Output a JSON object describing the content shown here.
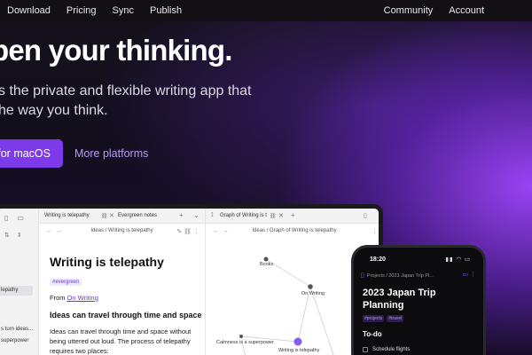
{
  "nav": {
    "left": [
      "Download",
      "Pricing",
      "Sync",
      "Publish"
    ],
    "right": [
      "Community",
      "Account"
    ]
  },
  "hero": {
    "headline": "pen your thinking.",
    "subtitle_line1": "s the private and flexible writing app that",
    "subtitle_line2": "he way you think.",
    "primary_button": "a for macOS",
    "secondary_link": "More platforms"
  },
  "colors": {
    "accent": "#7c3ae8",
    "link": "#b79cf5",
    "background": "#0d0b14"
  },
  "laptop": {
    "sidebar": {
      "active_item": "lepathy",
      "item1": "s turn ideas...",
      "item2": "superpower"
    },
    "pane1": {
      "tab_active": "Writing is telepathy",
      "tab_other": "Evergreen notes",
      "breadcrumb": "Ideas / Writing is telepathy",
      "title": "Writing is telepathy",
      "tag": "#evergreen",
      "from_label": "From ",
      "from_link": "On Writing",
      "heading": "Ideas can travel through time and space",
      "paragraph": "Ideas can travel through time and space without being uttered out loud. The process of telepathy requires two places:"
    },
    "pane2": {
      "tab": "Graph of Writing is t",
      "breadcrumb": "Ideas / Graph of Writing is telepathy",
      "nodes": {
        "books": "Books",
        "on_writing": "On Writing",
        "calmness": "Calmness is a superpower",
        "telepathy": "Writing is telepathy"
      }
    }
  },
  "phone": {
    "time": "18:20",
    "breadcrumb": "Projects / 2023 Japan Trip Pl...",
    "title": "2023 Japan Trip Planning",
    "tags": [
      "#projects",
      "#travel"
    ],
    "section": "To-do",
    "first_task": "Schedule flights"
  }
}
